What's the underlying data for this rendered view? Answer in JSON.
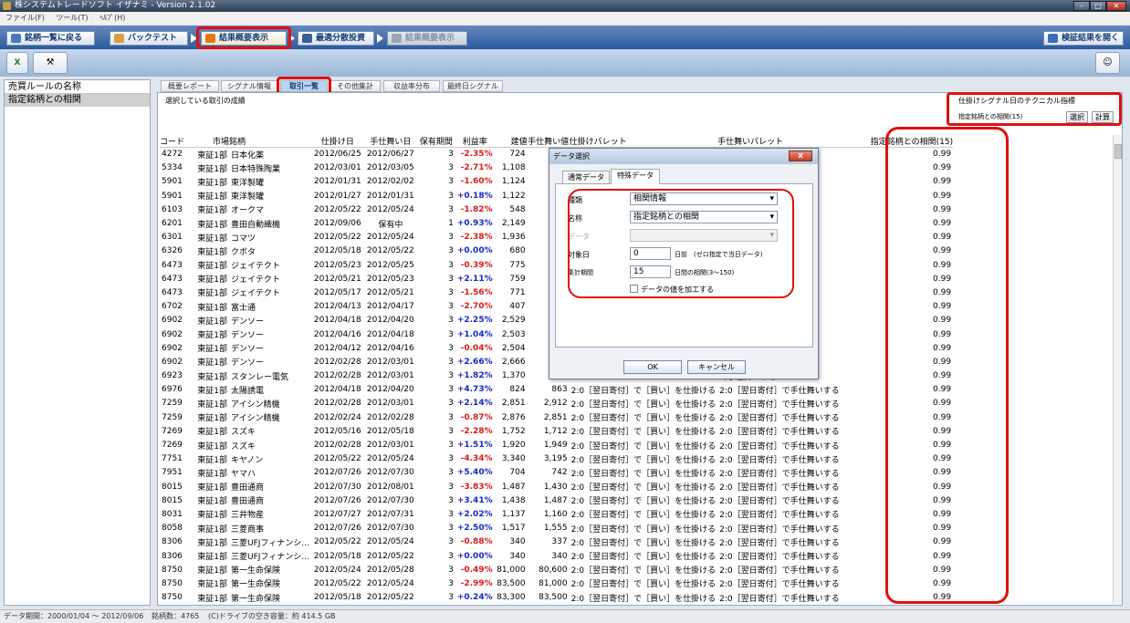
{
  "app": {
    "title": "株システムトレードソフト イザナミ - Version 2.1.02"
  },
  "menu": [
    "ファイル(F)",
    "ツール(T)",
    "ﾍﾙﾌﾟ(H)"
  ],
  "nav": {
    "back": "銘柄一覧に戻る",
    "backtest": "バックテスト",
    "summary": "結果概要表示",
    "optimize": "最適分散投資",
    "summary2": "結果概要表示",
    "open_result": "検証結果を開く"
  },
  "left": {
    "header": "売買ルールの名称",
    "item": "指定銘柄との相関"
  },
  "subtabs": [
    "概要レポート",
    "シグナル情報",
    "取引一覧",
    "その他集計",
    "収益率分布",
    "最終日シグナル"
  ],
  "main": {
    "subtitle": "選択している取引の成績",
    "indicator_title": "仕掛けシグナル日のテクニカル指標",
    "indicator_name": "指定銘柄との相関(15)",
    "select_btn": "選択",
    "calc_btn": "計算"
  },
  "columns": [
    "コード",
    "市場",
    "銘柄",
    "仕掛け日",
    "手仕舞い日",
    "保有期間",
    "利益率",
    "建値",
    "手仕舞い値",
    "仕掛けパレット",
    "手仕舞いパレット",
    "指定銘柄との相関(15)"
  ],
  "rows": [
    [
      "4272",
      "東証1部",
      "日本化薬",
      "2012/06/25",
      "2012/06/27",
      "3",
      "-2.35%",
      "724",
      "",
      "",
      "",
      "0.99"
    ],
    [
      "5334",
      "東証1部",
      "日本特殊陶業",
      "2012/03/01",
      "2012/03/05",
      "3",
      "-2.71%",
      "1,108",
      "",
      "",
      "",
      "0.99"
    ],
    [
      "5901",
      "東証1部",
      "東洋製罐",
      "2012/01/31",
      "2012/02/02",
      "3",
      "-1.60%",
      "1,124",
      "",
      "",
      "",
      "0.99"
    ],
    [
      "5901",
      "東証1部",
      "東洋製罐",
      "2012/01/27",
      "2012/01/31",
      "3",
      "+0.18%",
      "1,122",
      "",
      "",
      "",
      "0.99"
    ],
    [
      "6103",
      "東証1部",
      "オークマ",
      "2012/05/22",
      "2012/05/24",
      "3",
      "-1.82%",
      "548",
      "",
      "",
      "",
      "0.99"
    ],
    [
      "6201",
      "東証1部",
      "豊田自動織機",
      "2012/09/06",
      "保有中",
      "1",
      "+0.93%",
      "2,149",
      "",
      "",
      "",
      "0.99"
    ],
    [
      "6301",
      "東証1部",
      "コマツ",
      "2012/05/22",
      "2012/05/24",
      "3",
      "-2.38%",
      "1,936",
      "",
      "",
      "",
      "0.99"
    ],
    [
      "6326",
      "東証1部",
      "クボタ",
      "2012/05/18",
      "2012/05/22",
      "3",
      "+0.00%",
      "680",
      "",
      "",
      "",
      "0.99"
    ],
    [
      "6473",
      "東証1部",
      "ジェイテクト",
      "2012/05/23",
      "2012/05/25",
      "3",
      "-0.39%",
      "775",
      "",
      "",
      "",
      "0.99"
    ],
    [
      "6473",
      "東証1部",
      "ジェイテクト",
      "2012/05/21",
      "2012/05/23",
      "3",
      "+2.11%",
      "759",
      "",
      "",
      "",
      "0.99"
    ],
    [
      "6473",
      "東証1部",
      "ジェイテクト",
      "2012/05/17",
      "2012/05/21",
      "3",
      "-1.56%",
      "771",
      "",
      "",
      "",
      "0.99"
    ],
    [
      "6702",
      "東証1部",
      "富士通",
      "2012/04/13",
      "2012/04/17",
      "3",
      "-2.70%",
      "407",
      "",
      "",
      "",
      "0.99"
    ],
    [
      "6902",
      "東証1部",
      "デンソー",
      "2012/04/18",
      "2012/04/20",
      "3",
      "+2.25%",
      "2,529",
      "",
      "",
      "",
      "0.99"
    ],
    [
      "6902",
      "東証1部",
      "デンソー",
      "2012/04/16",
      "2012/04/18",
      "3",
      "+1.04%",
      "2,503",
      "",
      "",
      "",
      "0.99"
    ],
    [
      "6902",
      "東証1部",
      "デンソー",
      "2012/04/12",
      "2012/04/16",
      "3",
      "-0.04%",
      "2,504",
      "",
      "",
      "",
      "0.99"
    ],
    [
      "6902",
      "東証1部",
      "デンソー",
      "2012/02/28",
      "2012/03/01",
      "3",
      "+2.66%",
      "2,666",
      "",
      "",
      "",
      "0.99"
    ],
    [
      "6923",
      "東証1部",
      "スタンレー電気",
      "2012/02/28",
      "2012/03/01",
      "3",
      "+1.82%",
      "1,370",
      "",
      "",
      "",
      "0.99"
    ],
    [
      "6976",
      "東証1部",
      "太陽誘電",
      "2012/04/18",
      "2012/04/20",
      "3",
      "+4.73%",
      "824",
      "863",
      "2:0［翌日寄付］で［買い］を仕掛ける",
      "2:0［翌日寄付］で手仕舞いする",
      "0.99"
    ],
    [
      "7259",
      "東証1部",
      "アイシン精機",
      "2012/02/28",
      "2012/03/01",
      "3",
      "+2.14%",
      "2,851",
      "2,912",
      "2:0［翌日寄付］で［買い］を仕掛ける",
      "2:0［翌日寄付］で手仕舞いする",
      "0.99"
    ],
    [
      "7259",
      "東証1部",
      "アイシン精機",
      "2012/02/24",
      "2012/02/28",
      "3",
      "-0.87%",
      "2,876",
      "2,851",
      "2:0［翌日寄付］で［買い］を仕掛ける",
      "2:0［翌日寄付］で手仕舞いする",
      "0.99"
    ],
    [
      "7269",
      "東証1部",
      "スズキ",
      "2012/05/16",
      "2012/05/18",
      "3",
      "-2.28%",
      "1,752",
      "1,712",
      "2:0［翌日寄付］で［買い］を仕掛ける",
      "2:0［翌日寄付］で手仕舞いする",
      "0.99"
    ],
    [
      "7269",
      "東証1部",
      "スズキ",
      "2012/02/28",
      "2012/03/01",
      "3",
      "+1.51%",
      "1,920",
      "1,949",
      "2:0［翌日寄付］で［買い］を仕掛ける",
      "2:0［翌日寄付］で手仕舞いする",
      "0.99"
    ],
    [
      "7751",
      "東証1部",
      "キヤノン",
      "2012/05/22",
      "2012/05/24",
      "3",
      "-4.34%",
      "3,340",
      "3,195",
      "2:0［翌日寄付］で［買い］を仕掛ける",
      "2:0［翌日寄付］で手仕舞いする",
      "0.99"
    ],
    [
      "7951",
      "東証1部",
      "ヤマハ",
      "2012/07/26",
      "2012/07/30",
      "3",
      "+5.40%",
      "704",
      "742",
      "2:0［翌日寄付］で［買い］を仕掛ける",
      "2:0［翌日寄付］で手仕舞いする",
      "0.99"
    ],
    [
      "8015",
      "東証1部",
      "豊田通商",
      "2012/07/30",
      "2012/08/01",
      "3",
      "-3.83%",
      "1,487",
      "1,430",
      "2:0［翌日寄付］で［買い］を仕掛ける",
      "2:0［翌日寄付］で手仕舞いする",
      "0.99"
    ],
    [
      "8015",
      "東証1部",
      "豊田通商",
      "2012/07/26",
      "2012/07/30",
      "3",
      "+3.41%",
      "1,438",
      "1,487",
      "2:0［翌日寄付］で［買い］を仕掛ける",
      "2:0［翌日寄付］で手仕舞いする",
      "0.99"
    ],
    [
      "8031",
      "東証1部",
      "三井物産",
      "2012/07/27",
      "2012/07/31",
      "3",
      "+2.02%",
      "1,137",
      "1,160",
      "2:0［翌日寄付］で［買い］を仕掛ける",
      "2:0［翌日寄付］で手仕舞いする",
      "0.99"
    ],
    [
      "8058",
      "東証1部",
      "三菱商事",
      "2012/07/26",
      "2012/07/30",
      "3",
      "+2.50%",
      "1,517",
      "1,555",
      "2:0［翌日寄付］で［買い］を仕掛ける",
      "2:0［翌日寄付］で手仕舞いする",
      "0.99"
    ],
    [
      "8306",
      "東証1部",
      "三菱UFJフィナンシ...",
      "2012/05/22",
      "2012/05/24",
      "3",
      "-0.88%",
      "340",
      "337",
      "2:0［翌日寄付］で［買い］を仕掛ける",
      "2:0［翌日寄付］で手仕舞いする",
      "0.99"
    ],
    [
      "8306",
      "東証1部",
      "三菱UFJフィナンシ...",
      "2012/05/18",
      "2012/05/22",
      "3",
      "+0.00%",
      "340",
      "340",
      "2:0［翌日寄付］で［買い］を仕掛ける",
      "2:0［翌日寄付］で手仕舞いする",
      "0.99"
    ],
    [
      "8750",
      "東証1部",
      "第一生命保険",
      "2012/05/24",
      "2012/05/28",
      "3",
      "-0.49%",
      "81,000",
      "80,600",
      "2:0［翌日寄付］で［買い］を仕掛ける",
      "2:0［翌日寄付］で手仕舞いする",
      "0.99"
    ],
    [
      "8750",
      "東証1部",
      "第一生命保険",
      "2012/05/22",
      "2012/05/24",
      "3",
      "-2.99%",
      "83,500",
      "81,000",
      "2:0［翌日寄付］で［買い］を仕掛ける",
      "2:0［翌日寄付］で手仕舞いする",
      "0.99"
    ],
    [
      "8750",
      "東証1部",
      "第一生命保険",
      "2012/05/18",
      "2012/05/22",
      "3",
      "+0.24%",
      "83,300",
      "83,500",
      "2:0［翌日寄付］で［買い］を仕掛ける",
      "2:0［翌日寄付］で手仕舞いする",
      "0.99"
    ]
  ],
  "partial_exit_col": "で手仕舞いする",
  "dialog": {
    "title": "データ選択",
    "tab_normal": "通常データ",
    "tab_special": "特殊データ",
    "kind_label": "種類",
    "kind_value": "相関情報",
    "name_label": "名称",
    "name_value": "指定銘柄との相関",
    "data_label": "データ",
    "target_label": "対象日",
    "target_value": "0",
    "target_suffix": "日前　(ゼロ指定で当日データ)",
    "period_label": "集計期間",
    "period_value": "15",
    "period_suffix": "日間の相関(3〜150)",
    "process_label": "データの値を加工する",
    "ok": "OK",
    "cancel": "キャンセル",
    "close": "x"
  },
  "status": {
    "period": "データ期間：2000/01/04 〜 2012/09/06",
    "count": "銘柄数：4765",
    "disk": "(C)ドライブの空き容量：約 414.5 GB"
  },
  "colors": {
    "positive": "#1428c8",
    "negative": "#d81a1a",
    "highlight": "#e01010"
  }
}
